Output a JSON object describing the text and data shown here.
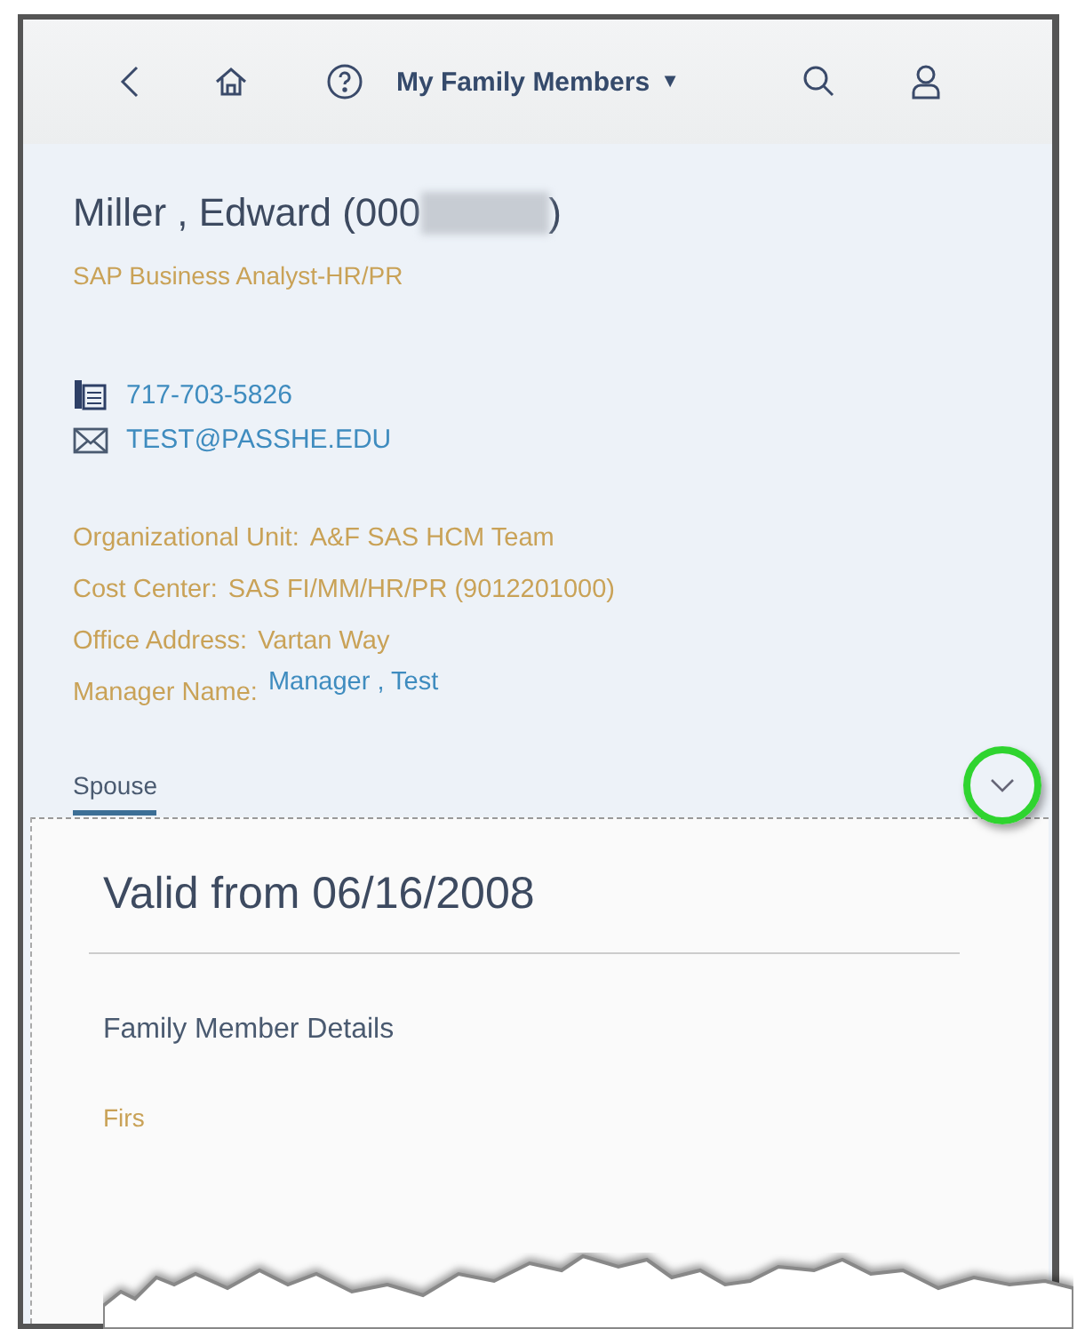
{
  "header": {
    "title": "My Family Members",
    "dropdown_glyph": "▼"
  },
  "profile": {
    "name_start": "Miller , Edward (000",
    "name_end": ")",
    "job_title": "SAP Business Analyst-HR/PR",
    "phone": "717-703-5826",
    "email": "TEST@PASSHE.EDU",
    "fields": [
      {
        "kind": "text",
        "label": "Organizational Unit:",
        "value": "A&F SAS HCM Team"
      },
      {
        "kind": "text",
        "label": "Cost Center:",
        "value": "SAS FI/MM/HR/PR (9012201000)"
      },
      {
        "kind": "text",
        "label": "Office Address:",
        "value": "Vartan Way"
      },
      {
        "kind": "link",
        "label": "Manager Name:",
        "value": "Manager , Test"
      }
    ]
  },
  "tabs": [
    {
      "label": "Spouse",
      "selected": true
    }
  ],
  "card": {
    "title": "Valid from 06/16/2008",
    "section": "Family Member Details",
    "cut_field": "Firs"
  }
}
